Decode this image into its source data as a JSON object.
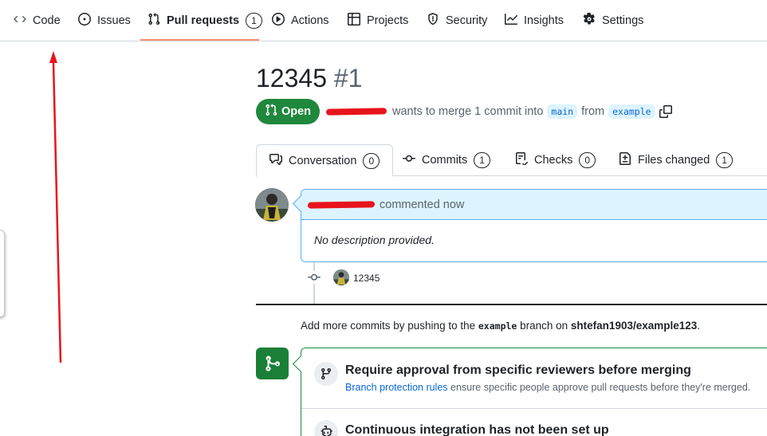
{
  "nav": {
    "items": [
      {
        "label": "Code",
        "icon": "code-icon"
      },
      {
        "label": "Issues",
        "icon": "issue-opened-icon"
      },
      {
        "label": "Pull requests",
        "icon": "git-pull-request-icon",
        "count": "1",
        "selected": true
      },
      {
        "label": "Actions",
        "icon": "play-icon"
      },
      {
        "label": "Projects",
        "icon": "table-icon"
      },
      {
        "label": "Security",
        "icon": "shield-icon"
      },
      {
        "label": "Insights",
        "icon": "graph-icon"
      },
      {
        "label": "Settings",
        "icon": "gear-icon"
      }
    ]
  },
  "pr": {
    "title": "12345",
    "number": "#1",
    "state": "Open",
    "meta": {
      "merge_text": "wants to merge 1 commit into",
      "base_branch": "main",
      "from_text": "from",
      "head_branch": "example"
    }
  },
  "tabs": [
    {
      "label": "Conversation",
      "count": "0",
      "icon": "comment-discussion-icon"
    },
    {
      "label": "Commits",
      "count": "1",
      "icon": "git-commit-icon"
    },
    {
      "label": "Checks",
      "count": "0",
      "icon": "checklist-icon"
    },
    {
      "label": "Files changed",
      "count": "1",
      "icon": "file-diff-icon"
    }
  ],
  "comment": {
    "action": "commented now",
    "body": "No description provided."
  },
  "commit": {
    "message": "12345"
  },
  "push_hint": {
    "prefix": "Add more commits by pushing to the",
    "branch": "example",
    "middle": "branch on",
    "repo": "shtefan1903/example123",
    "suffix": "."
  },
  "merge_box": {
    "approval_title": "Require approval from specific reviewers before merging",
    "approval_link": "Branch protection rules",
    "approval_desc": "ensure specific people approve pull requests before they're merged.",
    "ci_title": "Continuous integration has not been set up"
  },
  "colors": {
    "open_green": "#1f883d",
    "nav_underline": "#fd8c73",
    "annotation_red": "#e8141c",
    "link_blue": "#0969da"
  }
}
